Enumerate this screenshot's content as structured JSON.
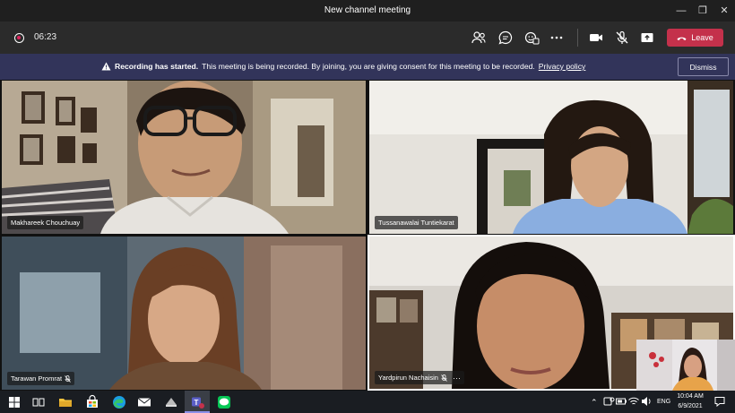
{
  "window": {
    "title": "New channel meeting"
  },
  "meeting": {
    "timer": "06:23",
    "leave_label": "Leave"
  },
  "banner": {
    "bold": "Recording has started.",
    "text": "This meeting is being recorded. By joining, you are giving consent for this meeting to be recorded.",
    "link": "Privacy policy",
    "dismiss_label": "Dismiss"
  },
  "participants": [
    {
      "name": "Makhareek Chouchuay"
    },
    {
      "name": "Tussanawalai Tuntiekarat"
    },
    {
      "name": "Tarawan Promrat"
    },
    {
      "name": "Yardpirun Nachaisin"
    }
  ],
  "taskbar": {
    "time": "10:04 AM",
    "date": "6/9/2021",
    "lang": "ENG"
  },
  "colors": {
    "leave": "#c4314b",
    "banner": "#32345a",
    "active_speaker": "#ffffff"
  }
}
